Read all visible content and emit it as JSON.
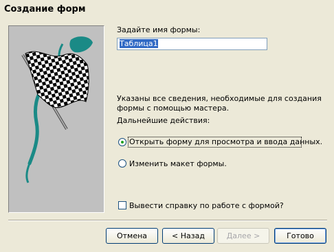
{
  "window": {
    "title": "Создание форм"
  },
  "form_name": {
    "label": "Задайте имя формы:",
    "value": "Таблица1"
  },
  "info": {
    "line1": "Указаны все сведения, необходимые для создания",
    "line2": "формы с помощью мастера.",
    "next_actions": "Дальнейшие действия:"
  },
  "options": [
    {
      "label": "Открыть форму для просмотра и ввода данных.",
      "selected": true
    },
    {
      "label": "Изменить макет формы.",
      "selected": false
    }
  ],
  "help_checkbox": {
    "label": "Вывести справку по работе с формой?",
    "checked": false
  },
  "buttons": {
    "cancel": "Отмена",
    "back": "< Назад",
    "next": "Далее >",
    "finish": "Готово"
  },
  "colors": {
    "flag_teal": "#1a8a86",
    "selection": "#316ac5",
    "panel": "#c0c0c0"
  }
}
